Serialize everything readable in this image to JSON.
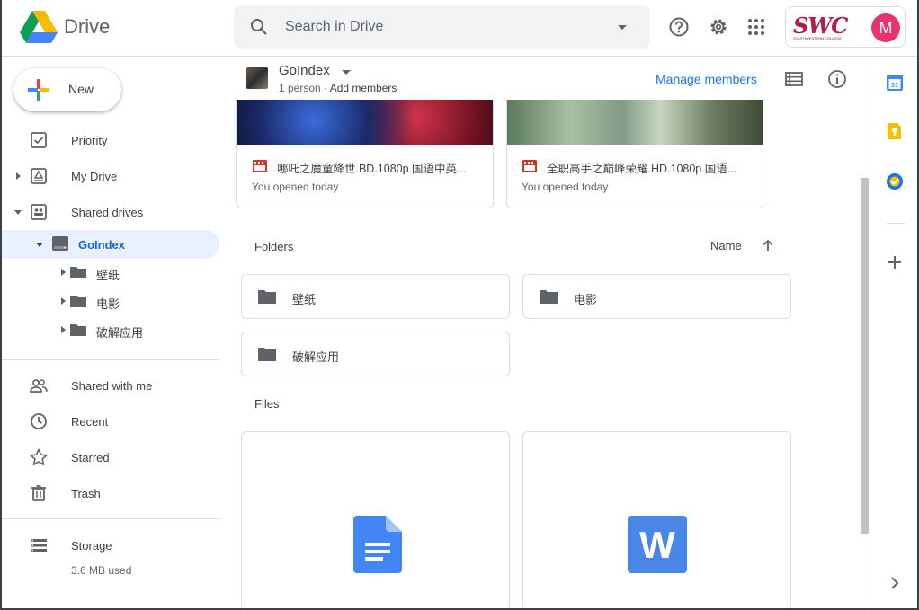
{
  "header": {
    "app_name": "Drive",
    "search_placeholder": "Search in Drive",
    "account_logo_text": "SWC",
    "account_logo_subtext": "SOUTHWESTERN COLLEGE",
    "avatar_letter": "M"
  },
  "sidebar": {
    "new_label": "New",
    "items": [
      {
        "label": "Priority",
        "icon": "check-square-icon"
      },
      {
        "label": "My Drive",
        "icon": "my-drive-icon"
      },
      {
        "label": "Shared drives",
        "icon": "shared-drives-icon"
      },
      {
        "label": "GoIndex",
        "icon": "drive-storage-icon"
      },
      {
        "label": "Shared with me",
        "icon": "people-icon"
      },
      {
        "label": "Recent",
        "icon": "clock-icon"
      },
      {
        "label": "Starred",
        "icon": "star-icon"
      },
      {
        "label": "Trash",
        "icon": "trash-icon"
      },
      {
        "label": "Storage",
        "icon": "storage-icon"
      }
    ],
    "subfolders": [
      "壁纸",
      "电影",
      "破解应用"
    ],
    "storage_used": "3.6 MB used"
  },
  "toolbar": {
    "drive_name": "GoIndex",
    "members": "1 person",
    "separator": "·",
    "add_members": "Add members",
    "manage_members": "Manage members"
  },
  "recent": [
    {
      "title": "哪吒之魔童降世.BD.1080p.国语中英...",
      "subtitle": "You opened today"
    },
    {
      "title": "全职高手之巅峰荣耀.HD.1080p.国语...",
      "subtitle": "You opened today"
    }
  ],
  "folders_section": {
    "label": "Folders",
    "sort_label": "Name",
    "folders": [
      "壁纸",
      "电影",
      "破解应用"
    ]
  },
  "files_section": {
    "label": "Files",
    "word_letter": "W"
  },
  "colors": {
    "accent_blue": "#1a73e8",
    "active_bg": "#e8f0fe",
    "video_red": "#d93025",
    "doc_blue": "#4285f4",
    "avatar_pink": "#e8336d"
  }
}
